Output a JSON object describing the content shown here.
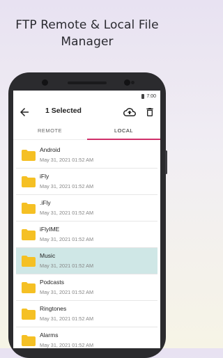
{
  "headline": {
    "line1": "FTP Remote & Local File",
    "line2": "Manager"
  },
  "status_bar": {
    "time": "7:00"
  },
  "app_bar": {
    "title": "1 Selected"
  },
  "tabs": [
    {
      "label": "REMOTE",
      "active": false
    },
    {
      "label": "LOCAL",
      "active": true
    }
  ],
  "accent_color": "#cf2f6a",
  "selected_row_color": "#cfe7e6",
  "folder_color": "#f5c024",
  "files": [
    {
      "name": "Android",
      "date": "May 31, 2021 01:52 AM",
      "selected": false
    },
    {
      "name": "iFly",
      "date": "May 31, 2021 01:52 AM",
      "selected": false
    },
    {
      "name": ".iFly",
      "date": "May 31, 2021 01:52 AM",
      "selected": false
    },
    {
      "name": "iFlyIME",
      "date": "May 31, 2021 01:52 AM",
      "selected": false
    },
    {
      "name": "Music",
      "date": "May 31, 2021 01:52 AM",
      "selected": true
    },
    {
      "name": "Podcasts",
      "date": "May 31, 2021 01:52 AM",
      "selected": false
    },
    {
      "name": "Ringtones",
      "date": "May 31, 2021 01:52 AM",
      "selected": false
    },
    {
      "name": "Alarms",
      "date": "May 31, 2021 01:52 AM",
      "selected": false
    }
  ]
}
